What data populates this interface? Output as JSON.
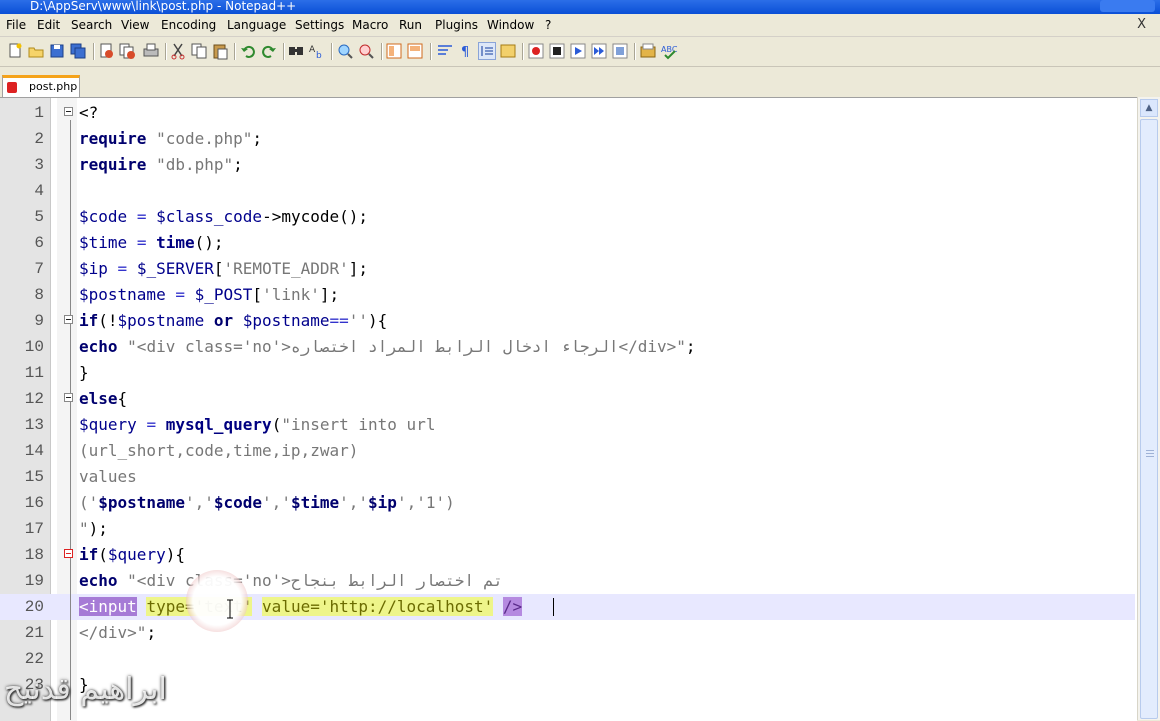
{
  "window": {
    "title": "D:\\AppServ\\www\\link\\post.php - Notepad++"
  },
  "menu": {
    "items": [
      "File",
      "Edit",
      "Search",
      "View",
      "Encoding",
      "Language",
      "Settings",
      "Macro",
      "Run",
      "Plugins",
      "Window",
      "?"
    ],
    "close_glyph": "X"
  },
  "toolbar": {
    "icons": [
      "new-file-icon",
      "open-file-icon",
      "save-icon",
      "save-all-icon",
      "close-icon",
      "close-all-icon",
      "print-icon",
      "cut-icon",
      "copy-icon",
      "paste-icon",
      "undo-icon",
      "redo-icon",
      "find-icon",
      "replace-icon",
      "zoom-in-icon",
      "zoom-out-icon",
      "sync-v-icon",
      "sync-h-icon",
      "wrap-icon",
      "all-chars-icon",
      "indent-guide-icon",
      "folder-icon",
      "record-macro-icon",
      "stop-macro-icon",
      "play-macro-icon",
      "run-macro-multiple-icon",
      "save-macro-icon",
      "monitor-icon",
      "spellcheck-icon"
    ]
  },
  "tabs": [
    {
      "label": "post.php",
      "active": true
    }
  ],
  "editor": {
    "lines": [
      {
        "n": "1",
        "tokens": [
          [
            "tag",
            "<?"
          ]
        ]
      },
      {
        "n": "2",
        "tokens": [
          [
            "kw",
            "require"
          ],
          [
            "plain",
            " "
          ],
          [
            "str",
            "\"code.php\""
          ],
          [
            "plain",
            ";"
          ]
        ]
      },
      {
        "n": "3",
        "tokens": [
          [
            "kw",
            "require"
          ],
          [
            "plain",
            " "
          ],
          [
            "str",
            "\"db.php\""
          ],
          [
            "plain",
            ";"
          ]
        ]
      },
      {
        "n": "4",
        "tokens": []
      },
      {
        "n": "5",
        "tokens": [
          [
            "var",
            "$code"
          ],
          [
            "plain",
            " "
          ],
          [
            "op",
            "="
          ],
          [
            "plain",
            " "
          ],
          [
            "var",
            "$class_code"
          ],
          [
            "plain",
            "->mycode();"
          ]
        ]
      },
      {
        "n": "6",
        "tokens": [
          [
            "var",
            "$time"
          ],
          [
            "plain",
            " "
          ],
          [
            "op",
            "="
          ],
          [
            "plain",
            " "
          ],
          [
            "fn",
            "time"
          ],
          [
            "plain",
            "();"
          ]
        ]
      },
      {
        "n": "7",
        "tokens": [
          [
            "var",
            "$ip"
          ],
          [
            "plain",
            " "
          ],
          [
            "op",
            "="
          ],
          [
            "plain",
            " "
          ],
          [
            "var",
            "$_SERVER"
          ],
          [
            "plain",
            "["
          ],
          [
            "str",
            "'REMOTE_ADDR'"
          ],
          [
            "plain",
            "];"
          ]
        ]
      },
      {
        "n": "8",
        "tokens": [
          [
            "var",
            "$postname"
          ],
          [
            "plain",
            " "
          ],
          [
            "op",
            "="
          ],
          [
            "plain",
            " "
          ],
          [
            "var",
            "$_POST"
          ],
          [
            "plain",
            "["
          ],
          [
            "str",
            "'link'"
          ],
          [
            "plain",
            "];"
          ]
        ]
      },
      {
        "n": "9",
        "tokens": [
          [
            "kw",
            "if"
          ],
          [
            "plain",
            "(!"
          ],
          [
            "var",
            "$postname"
          ],
          [
            "plain",
            " "
          ],
          [
            "kw",
            "or"
          ],
          [
            "plain",
            " "
          ],
          [
            "var",
            "$postname"
          ],
          [
            "op",
            "=="
          ],
          [
            "str",
            "''"
          ],
          [
            "plain",
            "){"
          ]
        ]
      },
      {
        "n": "10",
        "tokens": [
          [
            "kw",
            "echo"
          ],
          [
            "plain",
            " "
          ],
          [
            "str",
            "\"<div class='no'>الرجاء ادخال الرابط المراد اختصاره</div>\""
          ],
          [
            "plain",
            ";"
          ]
        ]
      },
      {
        "n": "11",
        "tokens": [
          [
            "plain",
            "}"
          ]
        ]
      },
      {
        "n": "12",
        "tokens": [
          [
            "kw",
            "else"
          ],
          [
            "plain",
            "{"
          ]
        ]
      },
      {
        "n": "13",
        "tokens": [
          [
            "var",
            "$query"
          ],
          [
            "plain",
            " "
          ],
          [
            "op",
            "="
          ],
          [
            "plain",
            " "
          ],
          [
            "fn",
            "mysql_query"
          ],
          [
            "plain",
            "("
          ],
          [
            "str",
            "\"insert into url"
          ]
        ]
      },
      {
        "n": "14",
        "tokens": [
          [
            "str",
            "(url_short,code,time,ip,zwar)"
          ]
        ]
      },
      {
        "n": "15",
        "tokens": [
          [
            "str",
            "values"
          ]
        ]
      },
      {
        "n": "16",
        "tokens": [
          [
            "str",
            "('"
          ],
          [
            "kw",
            "$postname"
          ],
          [
            "str",
            "','"
          ],
          [
            "kw",
            "$code"
          ],
          [
            "str",
            "','"
          ],
          [
            "kw",
            "$time"
          ],
          [
            "str",
            "','"
          ],
          [
            "kw",
            "$ip"
          ],
          [
            "str",
            "','1')"
          ]
        ]
      },
      {
        "n": "17",
        "tokens": [
          [
            "str",
            "\""
          ],
          [
            "plain",
            ");"
          ]
        ]
      },
      {
        "n": "18",
        "tokens": [
          [
            "kw",
            "if"
          ],
          [
            "plain",
            "("
          ],
          [
            "var",
            "$query"
          ],
          [
            "plain",
            "){"
          ]
        ]
      },
      {
        "n": "19",
        "tokens": [
          [
            "kw",
            "echo"
          ],
          [
            "plain",
            " "
          ],
          [
            "str",
            "\"<div class='no'>تم اختصار الرابط بنجاح"
          ]
        ]
      },
      {
        "n": "20",
        "tokens": [
          [
            "hl-tag",
            "<input"
          ],
          [
            "plain",
            " "
          ],
          [
            "hl-attr",
            "type='text'"
          ],
          [
            "plain",
            " "
          ],
          [
            "hl-attr",
            "value='http://localhost'"
          ],
          [
            "plain",
            " "
          ],
          [
            "hl-end",
            "/>"
          ]
        ]
      },
      {
        "n": "21",
        "tokens": [
          [
            "str",
            "</div>\""
          ],
          [
            "plain",
            ";"
          ]
        ]
      },
      {
        "n": "22",
        "tokens": []
      },
      {
        "n": "23",
        "tokens": [
          [
            "plain",
            "}"
          ]
        ]
      }
    ]
  },
  "watermark": "ابراهيم قدنيح"
}
